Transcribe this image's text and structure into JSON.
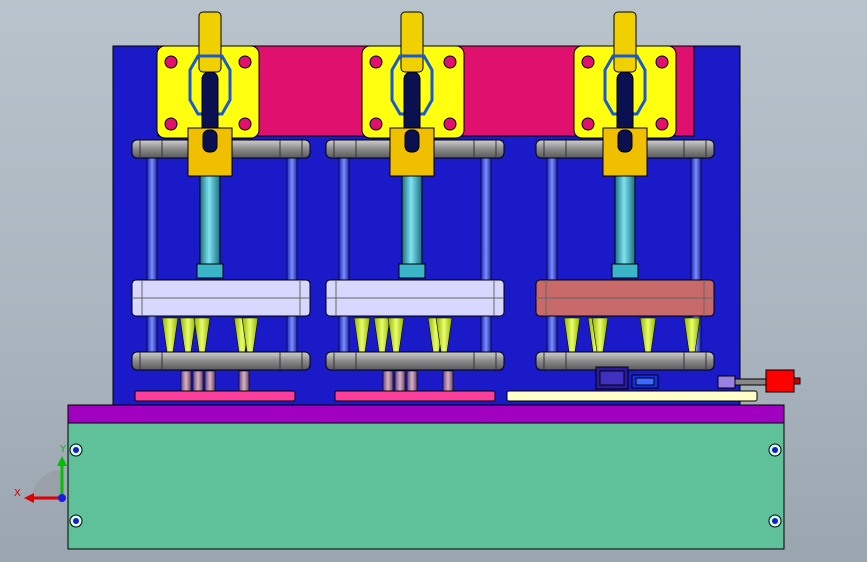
{
  "viewport": {
    "background": [
      "#bcc6cf",
      "#9aa5b0"
    ],
    "colors": {
      "back_plate": "#1a1ac8",
      "top_bar": "#e0106e",
      "clamp_plate": "#ffff10",
      "slider_plate": "#d8d8ff",
      "slider_plate_right": "#c86a6a",
      "rail": "#8a8a8a",
      "column": "#3a4ae8",
      "piston": "#3ab5c8",
      "nozzle": "#d4ff30",
      "base_top": "#a000c0",
      "base_body": "#5fc19a",
      "bottom_pad": "#ff3d9a",
      "bottom_pad_right": "#ffffc8",
      "side_cylinder": "#ff0000"
    }
  },
  "stations": [
    {
      "name": "station-left",
      "nozzle_count": 5
    },
    {
      "name": "station-middle",
      "nozzle_count": 5
    },
    {
      "name": "station-right",
      "nozzle_count": 5
    }
  ],
  "triad": {
    "x_label": "X",
    "y_label": "Y",
    "icons": [
      "axis-triad-icon",
      "x-axis-arrow-icon",
      "y-axis-arrow-icon",
      "z-axis-dot-icon"
    ]
  }
}
